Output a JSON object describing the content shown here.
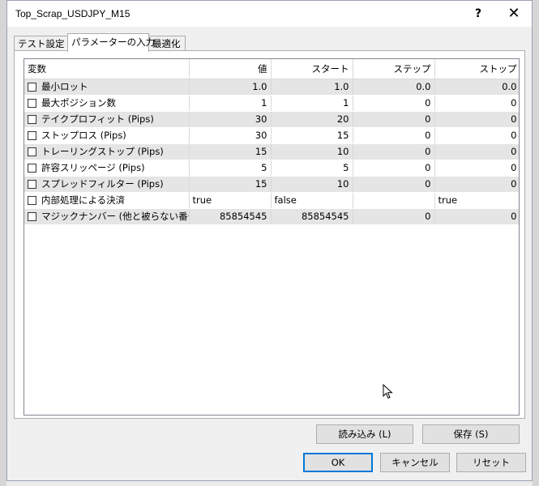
{
  "window": {
    "title": "Top_Scrap_USDJPY_M15",
    "help_label": "?",
    "close_label": "✕"
  },
  "tabs": [
    {
      "label": "テスト設定",
      "active": false
    },
    {
      "label": "パラメーターの入力",
      "active": true
    },
    {
      "label": "最適化",
      "active": false
    }
  ],
  "table": {
    "headers": [
      "変数",
      "値",
      "スタート",
      "ステップ",
      "ストップ"
    ],
    "rows": [
      {
        "name": "最小ロット",
        "value": "1.0",
        "start": "1.0",
        "step": "0.0",
        "stop": "0.0",
        "checked": false
      },
      {
        "name": "最大ポジション数",
        "value": "1",
        "start": "1",
        "step": "0",
        "stop": "0",
        "checked": false
      },
      {
        "name": "テイクプロフィット (Pips)",
        "value": "30",
        "start": "20",
        "step": "0",
        "stop": "0",
        "checked": false
      },
      {
        "name": "ストップロス (Pips)",
        "value": "30",
        "start": "15",
        "step": "0",
        "stop": "0",
        "checked": false
      },
      {
        "name": "トレーリングストップ (Pips)",
        "value": "15",
        "start": "10",
        "step": "0",
        "stop": "0",
        "checked": false
      },
      {
        "name": "許容スリッページ (Pips)",
        "value": "5",
        "start": "5",
        "step": "0",
        "stop": "0",
        "checked": false
      },
      {
        "name": "スプレッドフィルター (Pips)",
        "value": "15",
        "start": "10",
        "step": "0",
        "stop": "0",
        "checked": false
      },
      {
        "name": "内部処理による決済",
        "value": "true",
        "start": "false",
        "step": "",
        "stop": "true",
        "checked": false
      },
      {
        "name": "マジックナンバー (他と被らない番号)",
        "value": "85854545",
        "start": "85854545",
        "step": "0",
        "stop": "0",
        "checked": false
      }
    ]
  },
  "buttons": {
    "load": "読み込み (L)",
    "save": "保存 (S)",
    "ok": "OK",
    "cancel": "キャンセル",
    "reset": "リセット"
  }
}
